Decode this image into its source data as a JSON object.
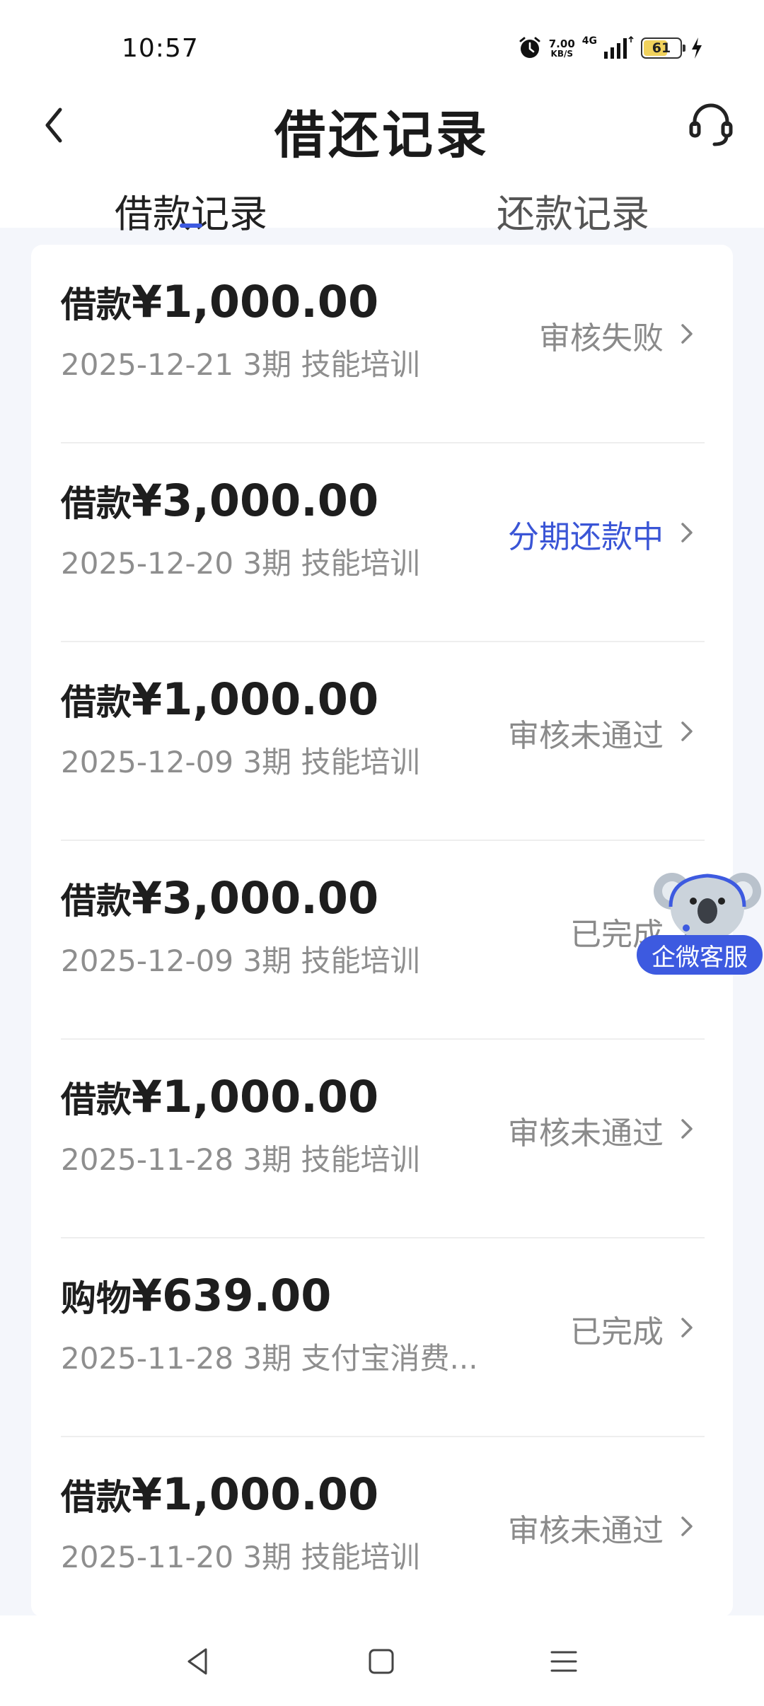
{
  "status_bar": {
    "time": "10:57",
    "net_speed_value": "7.00",
    "net_speed_unit": "KB/S",
    "network": "4G",
    "battery_level": "61",
    "icons": [
      "alarm-icon",
      "signal-icon",
      "battery-icon",
      "charging-icon"
    ]
  },
  "header": {
    "title": "借还记录",
    "back_icon": "chevron-left-icon",
    "support_icon": "headset-icon"
  },
  "tabs": [
    {
      "label": "借款记录",
      "active": true
    },
    {
      "label": "还款记录",
      "active": false
    }
  ],
  "records": [
    {
      "prefix": "借款",
      "amount": "¥1,000.00",
      "detail": "2025-12-21 3期  技能培训",
      "status": "审核失败",
      "status_color": "#8a8a8a"
    },
    {
      "prefix": "借款",
      "amount": "¥3,000.00",
      "detail": "2025-12-20 3期  技能培训",
      "status": "分期还款中",
      "status_color": "#3a55d6"
    },
    {
      "prefix": "借款",
      "amount": "¥1,000.00",
      "detail": "2025-12-09 3期  技能培训",
      "status": "审核未通过",
      "status_color": "#8a8a8a"
    },
    {
      "prefix": "借款",
      "amount": "¥3,000.00",
      "detail": "2025-12-09 3期  技能培训",
      "status": "已完成",
      "status_color": "#8a8a8a"
    },
    {
      "prefix": "借款",
      "amount": "¥1,000.00",
      "detail": "2025-11-28 3期  技能培训",
      "status": "审核未通过",
      "status_color": "#8a8a8a"
    },
    {
      "prefix": "购物",
      "amount": "¥639.00",
      "detail": "2025-11-28 3期  支付宝消费...",
      "status": "已完成",
      "status_color": "#8a8a8a"
    },
    {
      "prefix": "借款",
      "amount": "¥1,000.00",
      "detail": "2025-11-20 3期  技能培训",
      "status": "审核未通过",
      "status_color": "#8a8a8a"
    }
  ],
  "floating_service": {
    "label": "企微客服",
    "icon": "koala-mascot-icon"
  },
  "nav_bar": {
    "icons": [
      "back-triangle-icon",
      "home-square-icon",
      "menu-lines-icon"
    ]
  },
  "colors": {
    "accent": "#3d5ae0",
    "page_bg": "#f4f6fb"
  }
}
